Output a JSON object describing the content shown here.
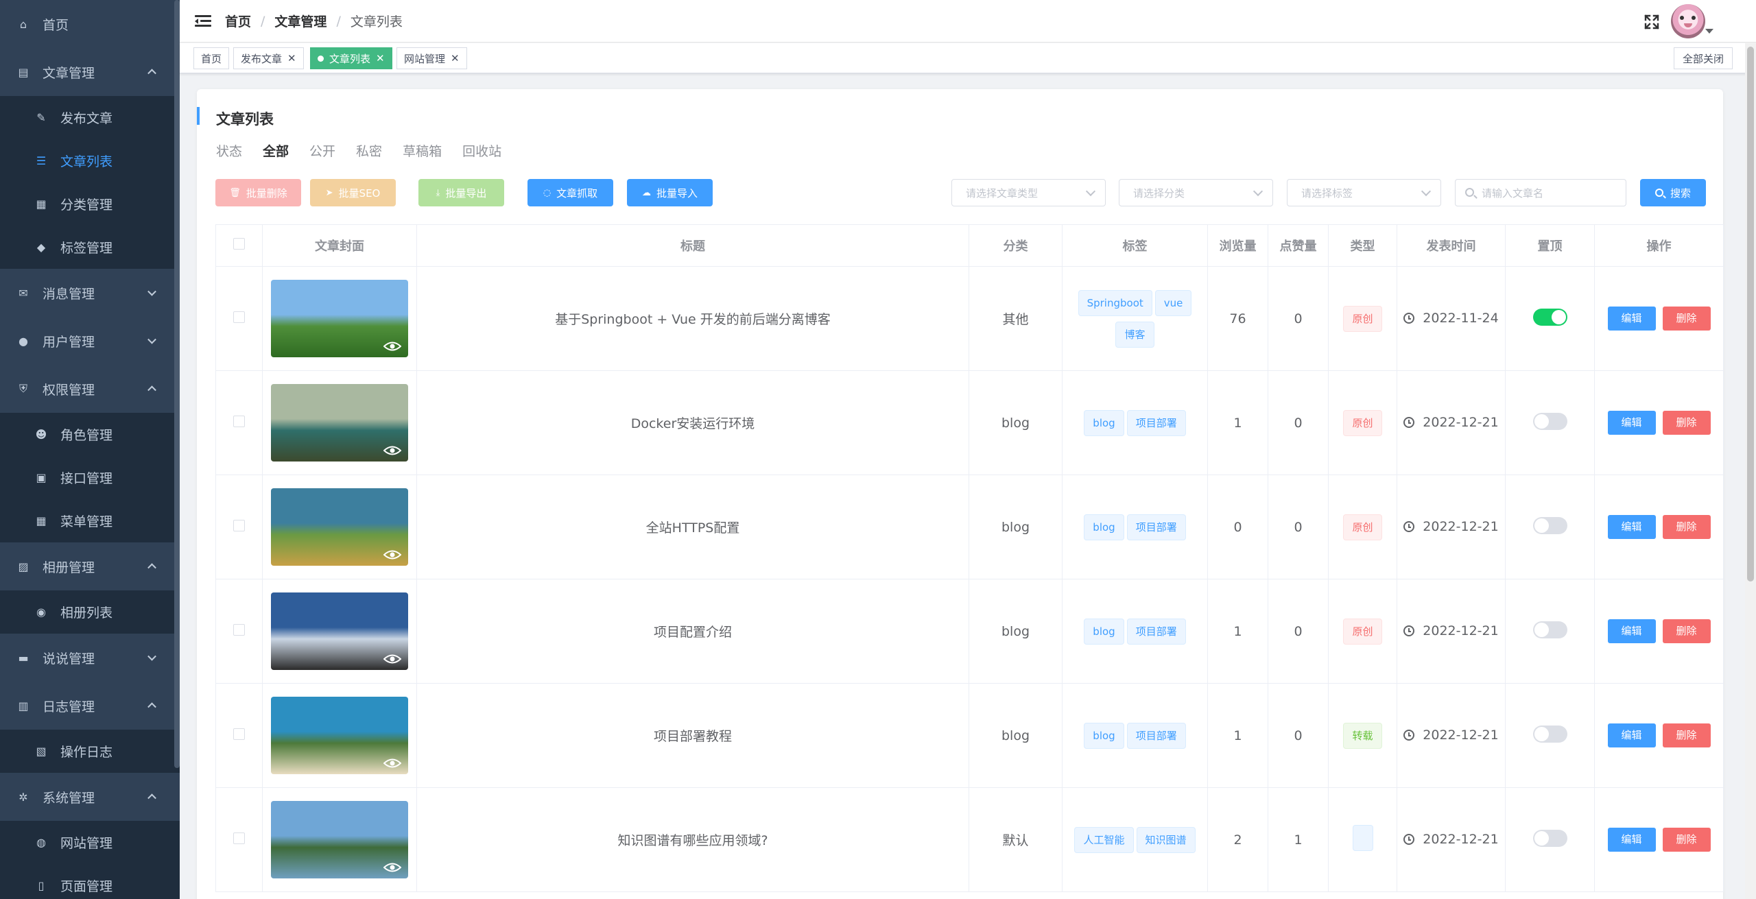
{
  "sidebar": {
    "items": [
      {
        "label": "首页",
        "icon": "home-icon",
        "level": 0
      },
      {
        "label": "文章管理",
        "icon": "document-icon",
        "level": 0,
        "expanded": true
      },
      {
        "label": "发布文章",
        "icon": "edit-icon",
        "level": 1
      },
      {
        "label": "文章列表",
        "icon": "list-icon",
        "level": 1,
        "active": true
      },
      {
        "label": "分类管理",
        "icon": "grid-icon",
        "level": 1
      },
      {
        "label": "标签管理",
        "icon": "tag-icon",
        "level": 1
      },
      {
        "label": "消息管理",
        "icon": "mail-icon",
        "level": 0,
        "expanded": false
      },
      {
        "label": "用户管理",
        "icon": "user-icon",
        "level": 0,
        "expanded": false
      },
      {
        "label": "权限管理",
        "icon": "shield-icon",
        "level": 0,
        "expanded": true
      },
      {
        "label": "角色管理",
        "icon": "users-icon",
        "level": 1
      },
      {
        "label": "接口管理",
        "icon": "api-icon",
        "level": 1
      },
      {
        "label": "菜单管理",
        "icon": "menu-icon",
        "level": 1
      },
      {
        "label": "相册管理",
        "icon": "picture-icon",
        "level": 0,
        "expanded": true
      },
      {
        "label": "相册列表",
        "icon": "camera-icon",
        "level": 1
      },
      {
        "label": "说说管理",
        "icon": "chat-icon",
        "level": 0,
        "expanded": false
      },
      {
        "label": "日志管理",
        "icon": "log-icon",
        "level": 0,
        "expanded": true
      },
      {
        "label": "操作日志",
        "icon": "record-icon",
        "level": 1
      },
      {
        "label": "系统管理",
        "icon": "gear-icon",
        "level": 0,
        "expanded": true
      },
      {
        "label": "网站管理",
        "icon": "globe-icon",
        "level": 1
      },
      {
        "label": "页面管理",
        "icon": "page-icon",
        "level": 1
      }
    ]
  },
  "header": {
    "breadcrumb": [
      "首页",
      "文章管理",
      "文章列表"
    ]
  },
  "tags": {
    "items": [
      {
        "label": "首页",
        "closable": false
      },
      {
        "label": "发布文章",
        "closable": true
      },
      {
        "label": "文章列表",
        "closable": true,
        "active": true
      },
      {
        "label": "网站管理",
        "closable": true
      }
    ],
    "close_all": "全部关闭"
  },
  "page": {
    "title": "文章列表",
    "status_label": "状态",
    "status_tabs": [
      "全部",
      "公开",
      "私密",
      "草稿箱",
      "回收站"
    ],
    "active_status": "全部"
  },
  "toolbar": {
    "batch_delete": "批量删除",
    "batch_seo": "批量SEO",
    "batch_export": "批量导出",
    "crawl": "文章抓取",
    "batch_import": "批量导入"
  },
  "filters": {
    "type_placeholder": "请选择文章类型",
    "category_placeholder": "请选择分类",
    "tag_placeholder": "请选择标签",
    "search_placeholder": "请输入文章名",
    "search_button": "搜索"
  },
  "table": {
    "columns": [
      "文章封面",
      "标题",
      "分类",
      "标签",
      "浏览量",
      "点赞量",
      "类型",
      "发表时间",
      "置顶",
      "操作"
    ],
    "edit_label": "编辑",
    "delete_label": "删除",
    "rows": [
      {
        "title": "基于Springboot + Vue 开发的前后端分离博客",
        "category": "其他",
        "tags": [
          "Springboot",
          "vue",
          "博客"
        ],
        "views": "76",
        "likes": "0",
        "type": "原创",
        "date": "2022-11-24",
        "top": true,
        "cover": [
          "#7db6e8",
          "#4f8f3a",
          "#2f6b22"
        ]
      },
      {
        "title": "Docker安装运行环境",
        "category": "blog",
        "tags": [
          "blog",
          "项目部署"
        ],
        "views": "1",
        "likes": "0",
        "type": "原创",
        "date": "2022-12-21",
        "top": false,
        "cover": [
          "#a9b8a0",
          "#2f6f6a",
          "#3c4a2e"
        ]
      },
      {
        "title": "全站HTTPS配置",
        "category": "blog",
        "tags": [
          "blog",
          "项目部署"
        ],
        "views": "0",
        "likes": "0",
        "type": "原创",
        "date": "2022-12-21",
        "top": false,
        "cover": [
          "#3d7f9e",
          "#6b9a43",
          "#c7a046"
        ]
      },
      {
        "title": "项目配置介绍",
        "category": "blog",
        "tags": [
          "blog",
          "项目部署"
        ],
        "views": "1",
        "likes": "0",
        "type": "原创",
        "date": "2022-12-21",
        "top": false,
        "cover": [
          "#2f5d9a",
          "#c9d5e3",
          "#2b2b2b"
        ]
      },
      {
        "title": "项目部署教程",
        "category": "blog",
        "tags": [
          "blog",
          "项目部署"
        ],
        "views": "1",
        "likes": "0",
        "type": "转载",
        "date": "2022-12-21",
        "top": false,
        "cover": [
          "#2c8fc1",
          "#4d7a3a",
          "#e8dcc0"
        ]
      },
      {
        "title": "知识图谱有哪些应用领域?",
        "category": "默认",
        "tags": [
          "人工智能",
          "知识图谱"
        ],
        "views": "2",
        "likes": "1",
        "type": "",
        "date": "2022-12-21",
        "top": false,
        "cover": [
          "#6fa6d6",
          "#3e6b3a",
          "#6f9fbf"
        ]
      }
    ]
  },
  "colors": {
    "sidebar_bg": "#304156",
    "primary": "#409eff",
    "danger": "#f56c6c",
    "success": "#13ce66",
    "tag_active": "#42b983"
  }
}
